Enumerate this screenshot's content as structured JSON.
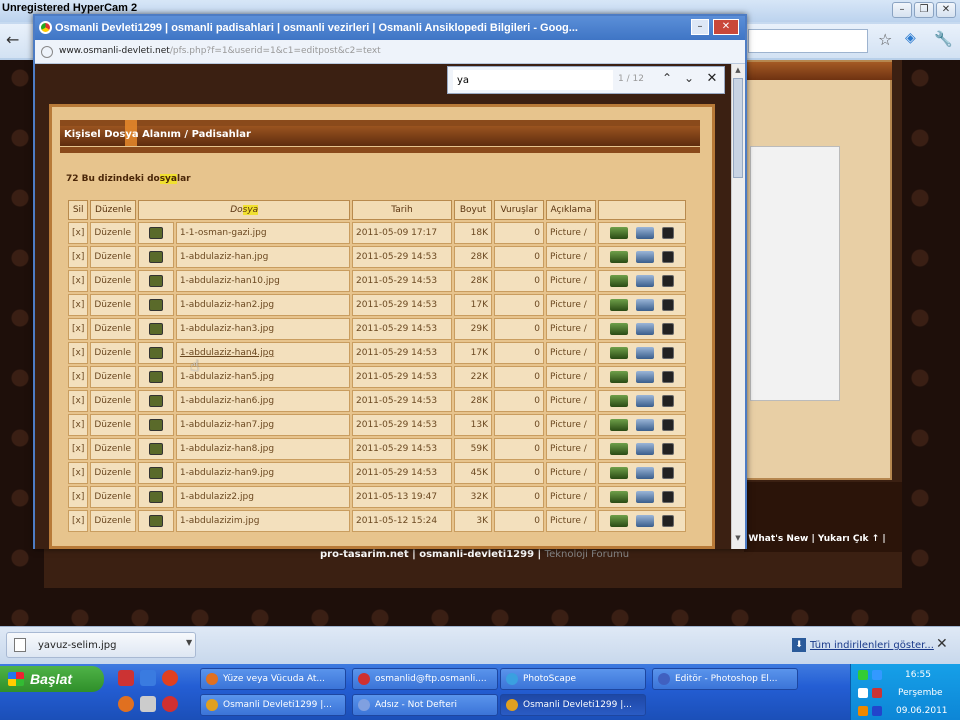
{
  "recorder_watermark": "Unregistered HyperCam 2",
  "popup": {
    "title": "Osmanli Devleti1299 | osmanli padisahlari | osmanli vezirleri | Osmanli Ansiklopedi Bilgileri - Goog...",
    "url_host": "www.osmanli-devleti.net",
    "url_path": "/pfs.php?f=1&userid=1&c1=editpost&c2=text",
    "find": {
      "query": "ya",
      "count": "1 / 12"
    },
    "section_title": "Kişisel Dosya Alanım / Padisahlar",
    "file_count_prefix": "72 Bu dizindeki do",
    "file_count_hl": "sya",
    "file_count_suffix": "lar",
    "columns": {
      "sil": "Sil",
      "duzenle": "Düzenle",
      "dosya_a": "Do",
      "dosya_hl": "sya",
      "tarih": "Tarih",
      "boyut": "Boyut",
      "vuruslar": "Vuruşlar",
      "aciklama": "Açıklama"
    },
    "rows": [
      {
        "sil": "[x]",
        "edit": "Düzenle",
        "file": "1-1-osman-gazi.jpg",
        "date": "2011-05-09 17:17",
        "size": "18K",
        "hits": "0",
        "desc": "Picture /"
      },
      {
        "sil": "[x]",
        "edit": "Düzenle",
        "file": "1-abdulaziz-han.jpg",
        "date": "2011-05-29 14:53",
        "size": "28K",
        "hits": "0",
        "desc": "Picture /"
      },
      {
        "sil": "[x]",
        "edit": "Düzenle",
        "file": "1-abdulaziz-han10.jpg",
        "date": "2011-05-29 14:53",
        "size": "28K",
        "hits": "0",
        "desc": "Picture /"
      },
      {
        "sil": "[x]",
        "edit": "Düzenle",
        "file": "1-abdulaziz-han2.jpg",
        "date": "2011-05-29 14:53",
        "size": "17K",
        "hits": "0",
        "desc": "Picture /"
      },
      {
        "sil": "[x]",
        "edit": "Düzenle",
        "file": "1-abdulaziz-han3.jpg",
        "date": "2011-05-29 14:53",
        "size": "29K",
        "hits": "0",
        "desc": "Picture /"
      },
      {
        "sil": "[x]",
        "edit": "Düzenle",
        "file": "1-abdulaziz-han4.jpg",
        "date": "2011-05-29 14:53",
        "size": "17K",
        "hits": "0",
        "desc": "Picture /"
      },
      {
        "sil": "[x]",
        "edit": "Düzenle",
        "file": "1-abdulaziz-han5.jpg",
        "date": "2011-05-29 14:53",
        "size": "22K",
        "hits": "0",
        "desc": "Picture /"
      },
      {
        "sil": "[x]",
        "edit": "Düzenle",
        "file": "1-abdulaziz-han6.jpg",
        "date": "2011-05-29 14:53",
        "size": "28K",
        "hits": "0",
        "desc": "Picture /"
      },
      {
        "sil": "[x]",
        "edit": "Düzenle",
        "file": "1-abdulaziz-han7.jpg",
        "date": "2011-05-29 14:53",
        "size": "13K",
        "hits": "0",
        "desc": "Picture /"
      },
      {
        "sil": "[x]",
        "edit": "Düzenle",
        "file": "1-abdulaziz-han8.jpg",
        "date": "2011-05-29 14:53",
        "size": "59K",
        "hits": "0",
        "desc": "Picture /"
      },
      {
        "sil": "[x]",
        "edit": "Düzenle",
        "file": "1-abdulaziz-han9.jpg",
        "date": "2011-05-29 14:53",
        "size": "45K",
        "hits": "0",
        "desc": "Picture /"
      },
      {
        "sil": "[x]",
        "edit": "Düzenle",
        "file": "1-abdulaziz2.jpg",
        "date": "2011-05-13 19:47",
        "size": "32K",
        "hits": "0",
        "desc": "Picture /"
      },
      {
        "sil": "[x]",
        "edit": "Düzenle",
        "file": "1-abdulazizim.jpg",
        "date": "2011-05-12 15:24",
        "size": "3K",
        "hits": "0",
        "desc": "Picture /"
      }
    ]
  },
  "page_footer": {
    "links": "| What's New | Yukarı Çık ↑ |",
    "main_a": "pro-tasarim.net | osmanli-devleti1299 | ",
    "main_b": "Teknoloji Forumu"
  },
  "download": {
    "file": "yavuz-selim.jpg",
    "show_all": "Tüm indirilenleri göster..."
  },
  "taskbar": {
    "start": "Başlat",
    "tasks_row1": [
      {
        "label": "Yüze veya Vücuda At...",
        "color": "#e07020"
      },
      {
        "label": "osmanlid@ftp.osmanli....",
        "color": "#d03030"
      },
      {
        "label": "PhotoScape",
        "color": "#3aa0e0"
      },
      {
        "label": "Editör - Photoshop El...",
        "color": "#4060c0"
      }
    ],
    "tasks_row2": [
      {
        "label": "Osmanli Devleti1299 |...",
        "color": "#e0a020"
      },
      {
        "label": "Adsız - Not Defteri",
        "color": "#80a0e0"
      },
      {
        "label": "Osmanli Devleti1299 |...",
        "color": "#e0a020"
      }
    ],
    "clock": {
      "time": "16:55",
      "day": "Perşembe",
      "date": "09.06.2011"
    }
  }
}
